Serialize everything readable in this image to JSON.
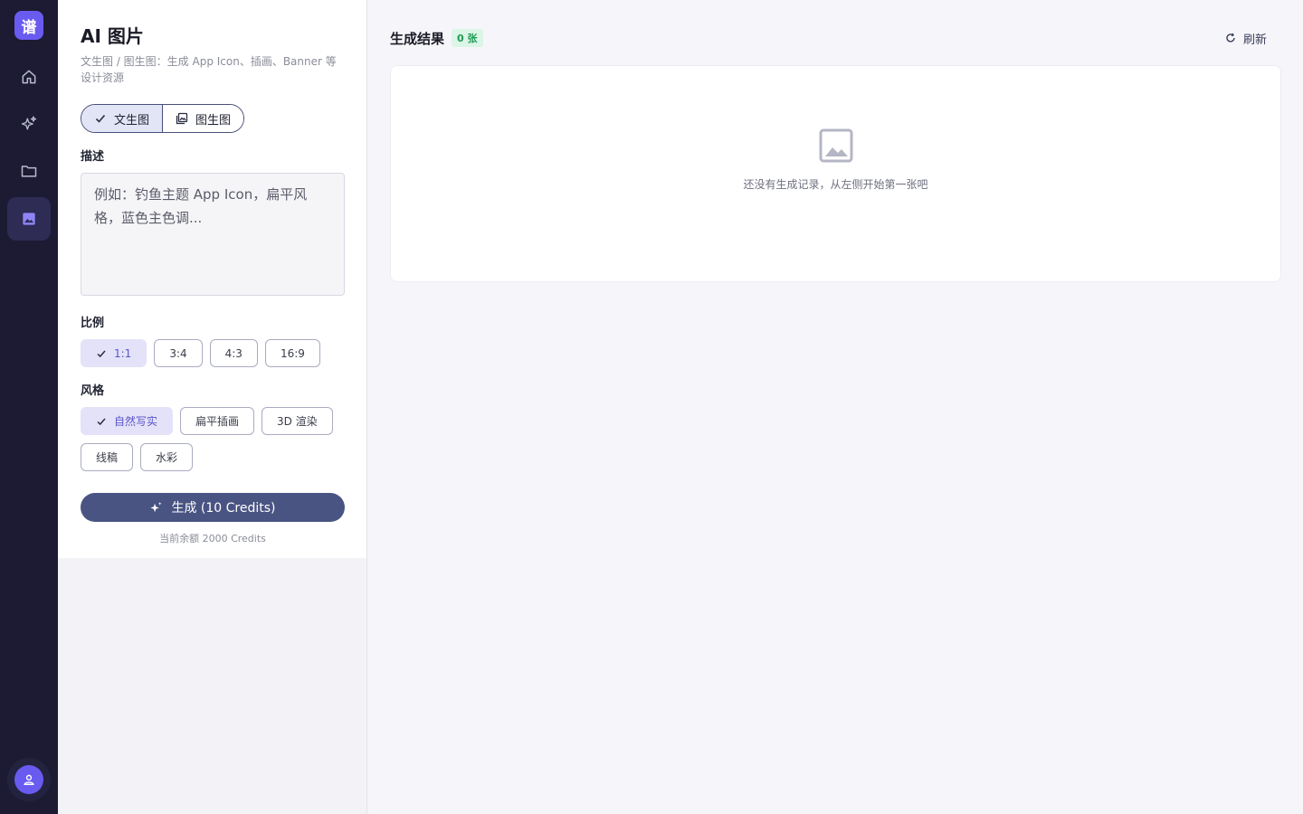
{
  "rail": {
    "logo_text": "谱",
    "items": [
      {
        "name": "home-icon"
      },
      {
        "name": "sparkles-icon"
      },
      {
        "name": "folder-icon"
      },
      {
        "name": "image-icon",
        "active": true
      }
    ],
    "avatar_icon": "user-icon"
  },
  "panel": {
    "title": "AI 图片",
    "subtitle": "文生图 / 图生图：生成 App Icon、插画、Banner 等设计资源",
    "modes": [
      {
        "label": "文生图",
        "active": true,
        "icon": "check-icon"
      },
      {
        "label": "图生图",
        "active": false,
        "icon": "images-icon"
      }
    ],
    "prompt_label": "描述",
    "prompt_placeholder": "例如：钓鱼主题 App Icon，扁平风格，蓝色主色调...",
    "ratio_label": "比例",
    "ratios": [
      {
        "label": "1:1",
        "active": true
      },
      {
        "label": "3:4",
        "active": false
      },
      {
        "label": "4:3",
        "active": false
      },
      {
        "label": "16:9",
        "active": false
      }
    ],
    "style_label": "风格",
    "styles": [
      {
        "label": "自然写实",
        "active": true
      },
      {
        "label": "扁平插画",
        "active": false
      },
      {
        "label": "3D 渲染",
        "active": false
      },
      {
        "label": "线稿",
        "active": false
      },
      {
        "label": "水彩",
        "active": false
      }
    ],
    "generate_label": "生成 (10 Credits)",
    "balance": "当前余额 2000 Credits"
  },
  "results": {
    "title": "生成结果",
    "count_badge": "0 张",
    "refresh_label": "刷新",
    "empty_text": "还没有生成记录，从左侧开始第一张吧"
  },
  "colors": {
    "rail_bg": "#1c1b33",
    "accent": "#6a5bf0",
    "primary_button": "#4a5482",
    "badge_green": "#1e9a52"
  }
}
